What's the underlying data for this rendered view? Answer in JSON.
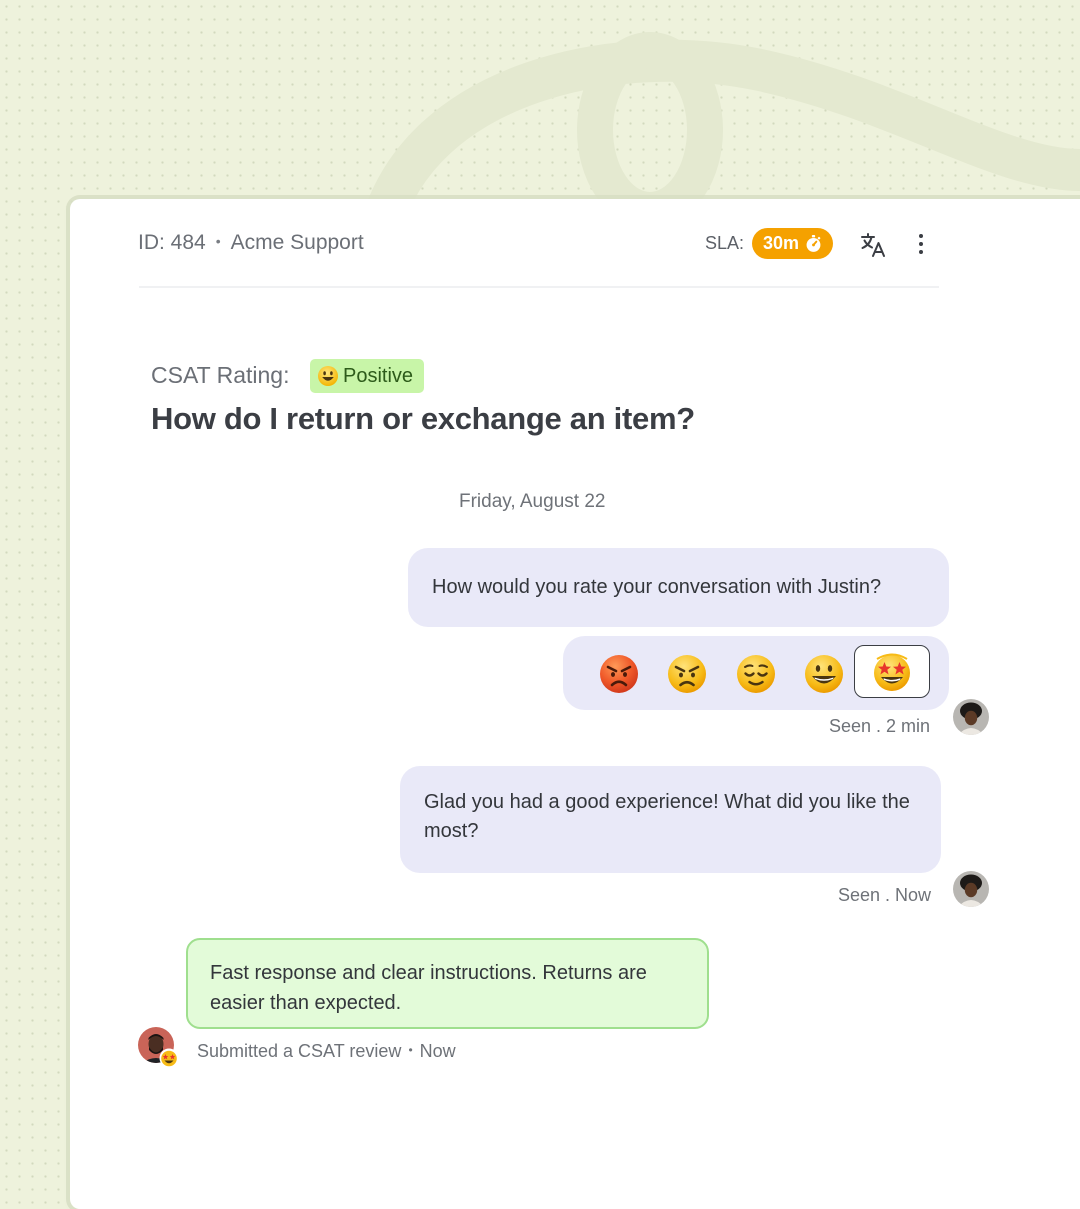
{
  "header": {
    "ticket_id": "ID: 484",
    "separator": "•",
    "team_name": "Acme Support",
    "sla_label": "SLA:",
    "sla_value": "30m",
    "sla_icon": "stopwatch-icon",
    "translate_icon": "translate-icon",
    "menu_icon": "more-vertical-icon"
  },
  "csat": {
    "label": "CSAT Rating:",
    "badge_icon": "smiley-icon",
    "badge_text": "Positive"
  },
  "title": "How do I return or exchange an item?",
  "conversation": {
    "date": "Friday, August 22",
    "question": "How would you rate your conversation with Justin?",
    "rating_options": [
      "very-angry-face",
      "angry-face",
      "relieved-face",
      "smiling-face",
      "star-struck-face"
    ],
    "selected_rating": "star-struck-face",
    "seen_1": "Seen . 2 min",
    "agent_followup": "Glad you had a good experience! What did you like the most?",
    "seen_2": "Seen . Now",
    "customer_review": "Fast response and clear instructions. Returns are easier than expected.",
    "review_note": "Submitted a CSAT review",
    "review_sep": "•",
    "review_time": "Now"
  },
  "colors": {
    "sla_badge": "#f5a100",
    "csat_badge": "#c8f5a8",
    "agent_bubble": "#e9e9f8",
    "customer_bubble": "#e3fbd9",
    "customer_bubble_border": "#9fdf8e",
    "page_background": "#eef2dc"
  }
}
